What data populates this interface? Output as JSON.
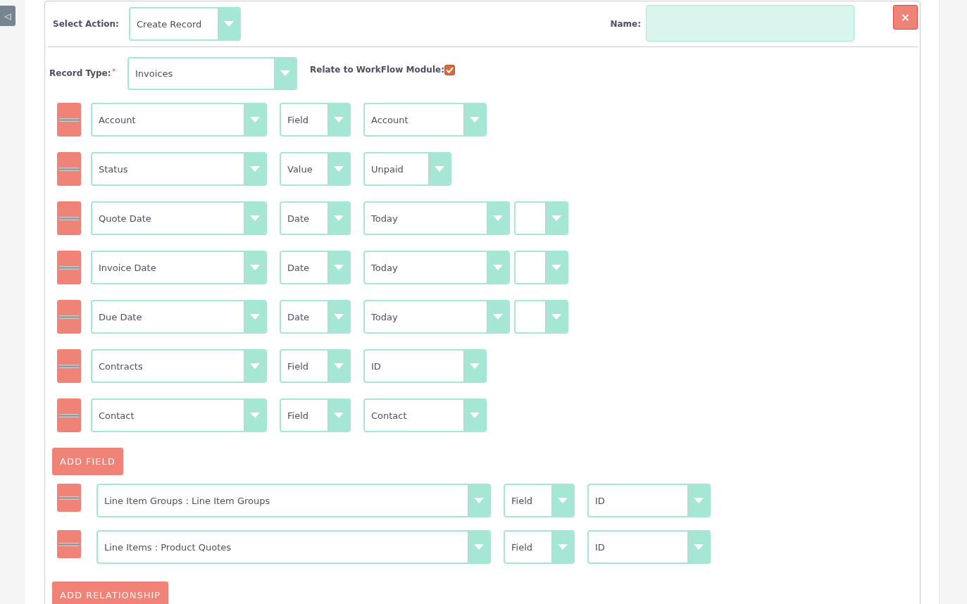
{
  "sidebar_toggle": {
    "glyph": "◁"
  },
  "action": {
    "label": "Select Action:",
    "value": "Create Record"
  },
  "name_field": {
    "label": "Name:"
  },
  "close_button": {
    "glyph": "×"
  },
  "record_type": {
    "label": "Record Type:",
    "required_mark": "*",
    "value": "Invoices"
  },
  "relate_to_workflow": {
    "label": "Relate to WorkFlow Module:",
    "checked": true
  },
  "fields": [
    {
      "kind": "wide",
      "field": "Account",
      "type": "Field",
      "value": "Account"
    },
    {
      "kind": "narrow",
      "field": "Status",
      "type": "Value",
      "value": "Unpaid"
    },
    {
      "kind": "date",
      "field": "Quote Date",
      "type": "Date",
      "value": "Today"
    },
    {
      "kind": "date",
      "field": "Invoice Date",
      "type": "Date",
      "value": "Today"
    },
    {
      "kind": "date",
      "field": "Due Date",
      "type": "Date",
      "value": "Today"
    },
    {
      "kind": "wide",
      "field": "Contracts",
      "type": "Field",
      "value": "ID"
    },
    {
      "kind": "wide",
      "field": "Contact",
      "type": "Field",
      "value": "Contact"
    }
  ],
  "add_field_button": "ADD FIELD",
  "relationships": [
    {
      "relation": "Line Item Groups : Line Item Groups",
      "type": "Field",
      "value": "ID"
    },
    {
      "relation": "Line Items : Product Quotes",
      "type": "Field",
      "value": "ID"
    }
  ],
  "add_relationship_button": "ADD RELATIONSHIP"
}
